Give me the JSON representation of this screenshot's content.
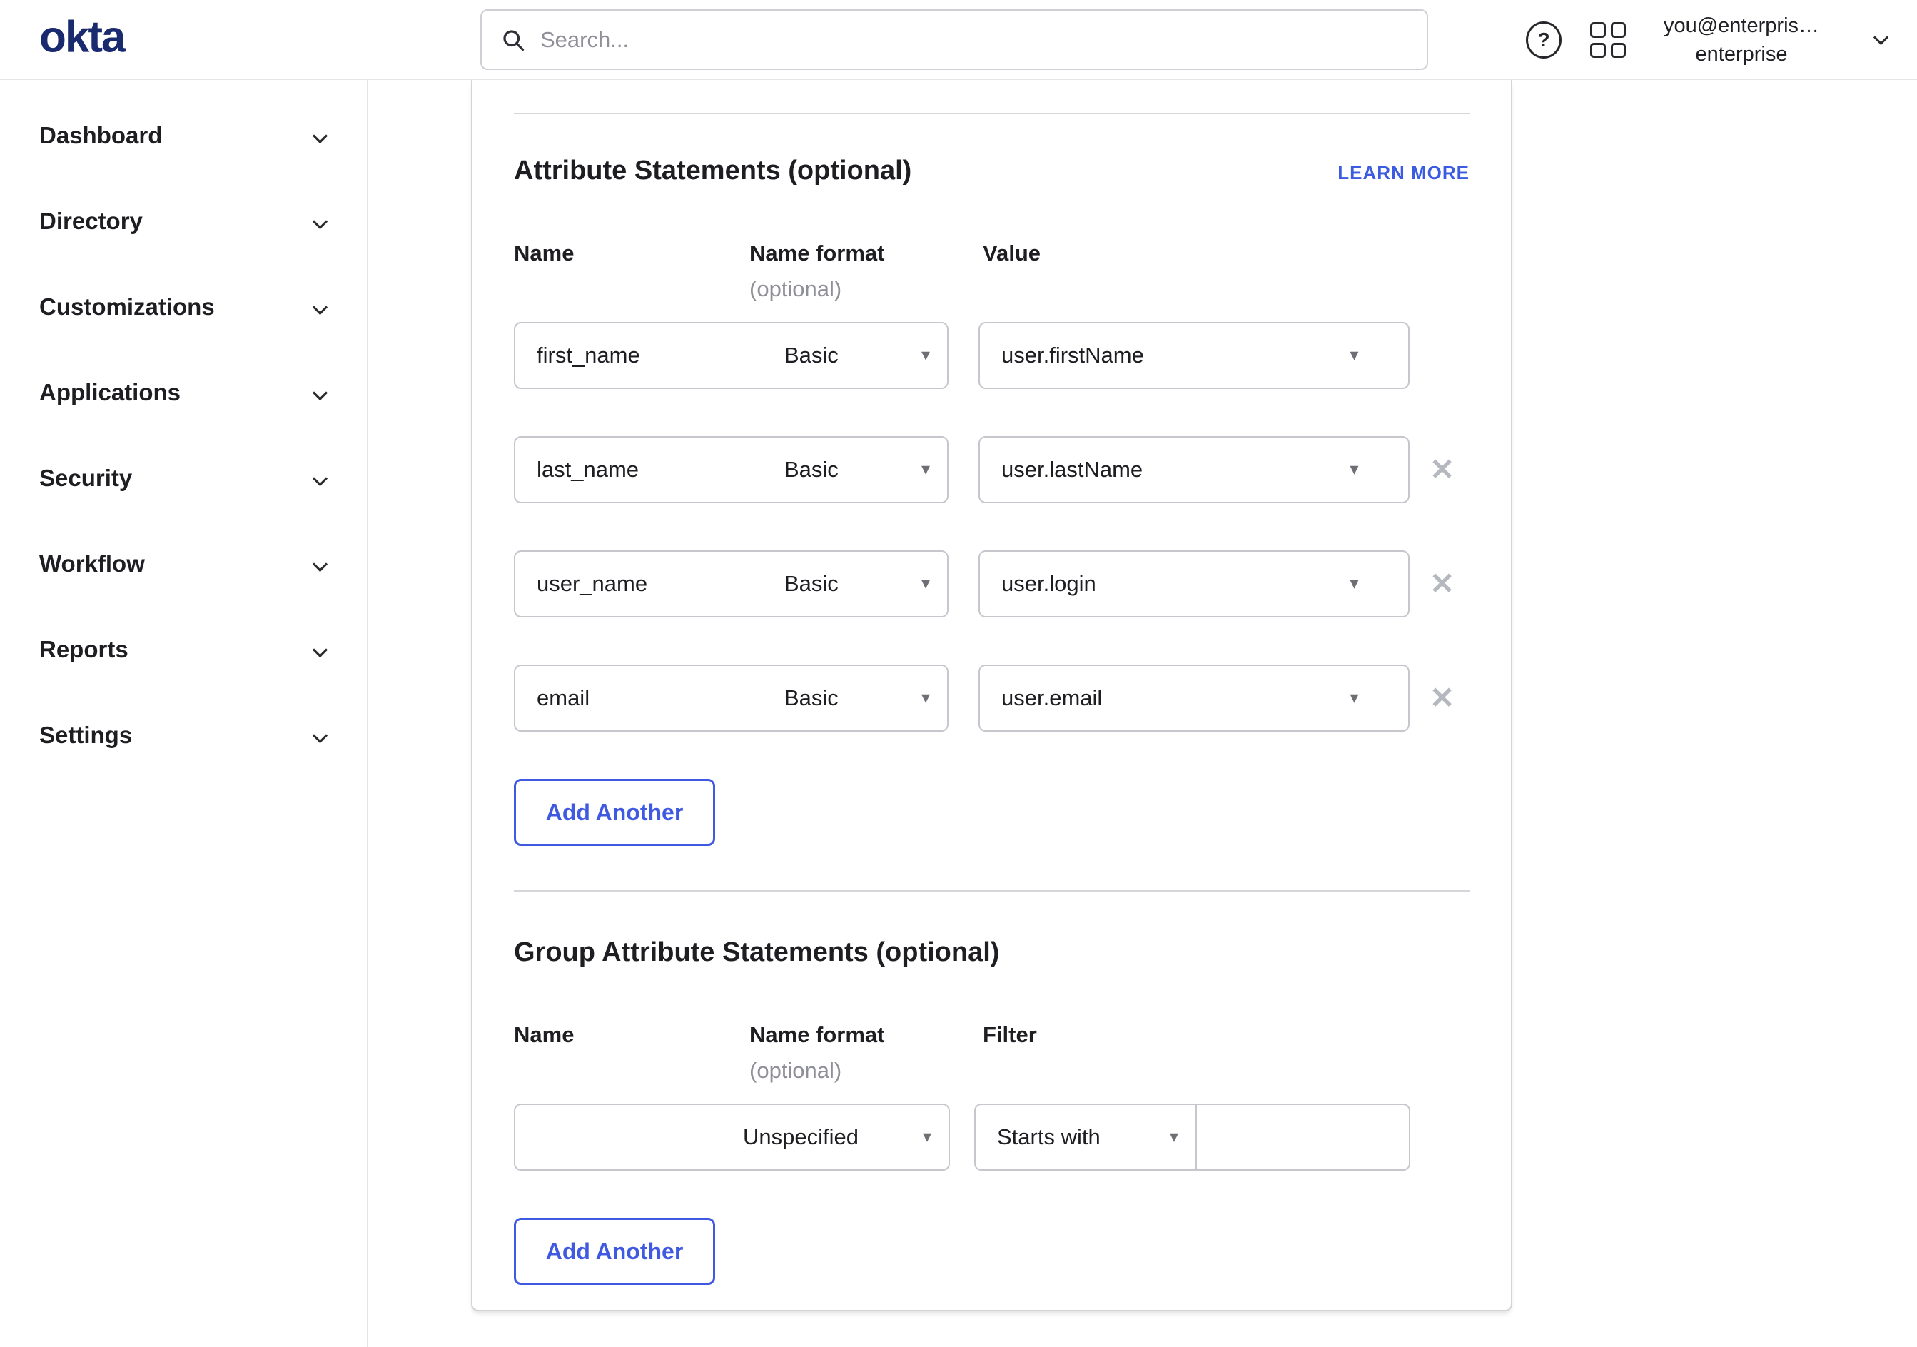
{
  "colors": {
    "brand_navy": "#1a2a6e",
    "link_blue": "#3b5be0",
    "button_blue": "#3f59e0",
    "text_dark": "#1d1d22",
    "text_muted": "#8f8f98",
    "input_border": "#c6c6cc",
    "divider": "#d6d6da"
  },
  "icons": {
    "caret": "▾",
    "remove": "✕",
    "help": "?"
  },
  "header": {
    "logo": "okta",
    "search": {
      "placeholder": "Search..."
    },
    "account": {
      "line1": "you@enterpris…",
      "line2": "enterprise"
    }
  },
  "sidebar": {
    "items": [
      {
        "label": "Dashboard"
      },
      {
        "label": "Directory"
      },
      {
        "label": "Customizations"
      },
      {
        "label": "Applications"
      },
      {
        "label": "Security"
      },
      {
        "label": "Workflow"
      },
      {
        "label": "Reports"
      },
      {
        "label": "Settings"
      }
    ]
  },
  "main": {
    "attribute_section": {
      "title": "Attribute Statements (optional)",
      "learn_more": "LEARN MORE",
      "columns": {
        "name": "Name",
        "format": "Name format",
        "format_note": "(optional)",
        "value": "Value"
      },
      "rows": [
        {
          "name": "first_name",
          "format": "Basic",
          "value": "user.firstName"
        },
        {
          "name": "last_name",
          "format": "Basic",
          "value": "user.lastName"
        },
        {
          "name": "user_name",
          "format": "Basic",
          "value": "user.login"
        },
        {
          "name": "email",
          "format": "Basic",
          "value": "user.email"
        }
      ],
      "add_button": "Add Another"
    },
    "group_section": {
      "title": "Group Attribute Statements (optional)",
      "columns": {
        "name": "Name",
        "format": "Name format",
        "format_note": "(optional)",
        "filter": "Filter"
      },
      "rows": [
        {
          "name": "",
          "format": "Unspecified",
          "filter_type": "Starts with",
          "filter_value": ""
        }
      ],
      "add_button": "Add Another"
    }
  }
}
